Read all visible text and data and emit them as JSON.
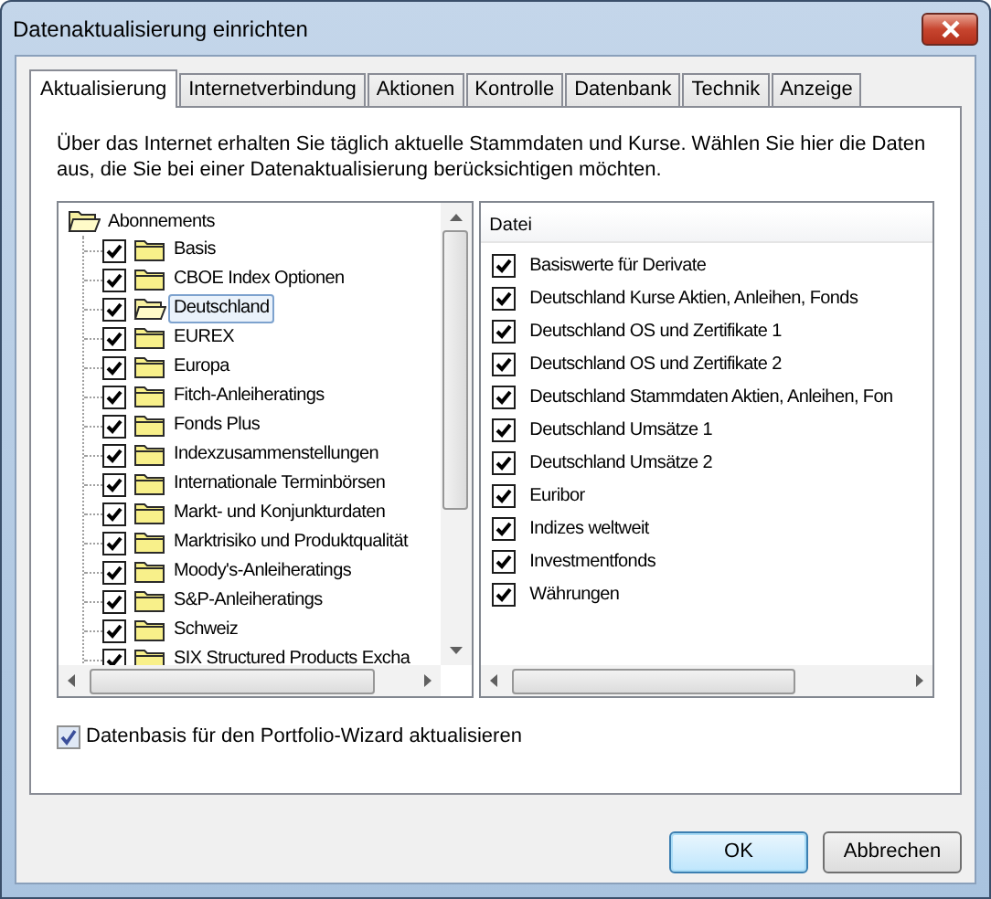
{
  "window": {
    "title": "Datenaktualisierung einrichten"
  },
  "tabs": [
    {
      "label": "Aktualisierung",
      "selected": true
    },
    {
      "label": "Internetverbindung",
      "selected": false
    },
    {
      "label": "Aktionen",
      "selected": false
    },
    {
      "label": "Kontrolle",
      "selected": false
    },
    {
      "label": "Datenbank",
      "selected": false
    },
    {
      "label": "Technik",
      "selected": false
    },
    {
      "label": "Anzeige",
      "selected": false
    }
  ],
  "description": "Über das Internet erhalten Sie täglich aktuelle Stammdaten und Kurse. Wählen Sie hier die Daten aus, die Sie bei einer Datenaktualisierung berücksichtigen möchten.",
  "tree": {
    "label": "Abonnements",
    "expanded": true,
    "children": [
      {
        "label": "Basis",
        "checked": true,
        "selected": false
      },
      {
        "label": "CBOE Index Optionen",
        "checked": true,
        "selected": false
      },
      {
        "label": "Deutschland",
        "checked": true,
        "selected": true
      },
      {
        "label": "EUREX",
        "checked": true,
        "selected": false
      },
      {
        "label": "Europa",
        "checked": true,
        "selected": false
      },
      {
        "label": "Fitch-Anleiheratings",
        "checked": true,
        "selected": false
      },
      {
        "label": "Fonds Plus",
        "checked": true,
        "selected": false
      },
      {
        "label": "Indexzusammenstellungen",
        "checked": true,
        "selected": false
      },
      {
        "label": "Internationale Terminbörsen",
        "checked": true,
        "selected": false
      },
      {
        "label": "Markt- und Konjunkturdaten",
        "checked": true,
        "selected": false
      },
      {
        "label": "Marktrisiko und Produktqualität",
        "checked": true,
        "selected": false
      },
      {
        "label": "Moody's-Anleiheratings",
        "checked": true,
        "selected": false
      },
      {
        "label": "S&P-Anleiheratings",
        "checked": true,
        "selected": false
      },
      {
        "label": "Schweiz",
        "checked": true,
        "selected": false
      },
      {
        "label": "SIX Structured Products Excha",
        "checked": true,
        "selected": false
      }
    ]
  },
  "file_list": {
    "column": "Datei",
    "items": [
      {
        "label": "Basiswerte für Derivate",
        "checked": true
      },
      {
        "label": "Deutschland Kurse Aktien, Anleihen, Fonds",
        "checked": true
      },
      {
        "label": "Deutschland OS und Zertifikate 1",
        "checked": true
      },
      {
        "label": "Deutschland OS und Zertifikate 2",
        "checked": true
      },
      {
        "label": "Deutschland Stammdaten Aktien, Anleihen, Fon",
        "checked": true
      },
      {
        "label": "Deutschland Umsätze 1",
        "checked": true
      },
      {
        "label": "Deutschland Umsätze 2",
        "checked": true
      },
      {
        "label": "Euribor",
        "checked": true
      },
      {
        "label": "Indizes weltweit",
        "checked": true
      },
      {
        "label": "Investmentfonds",
        "checked": true
      },
      {
        "label": "Währungen",
        "checked": true
      }
    ]
  },
  "portfolio_option": {
    "label": "Datenbasis für den Portfolio-Wizard aktualisieren",
    "checked": true
  },
  "buttons": [
    {
      "label": "OK",
      "kind": "default"
    },
    {
      "label": "Abbrechen",
      "kind": "normal"
    }
  ]
}
